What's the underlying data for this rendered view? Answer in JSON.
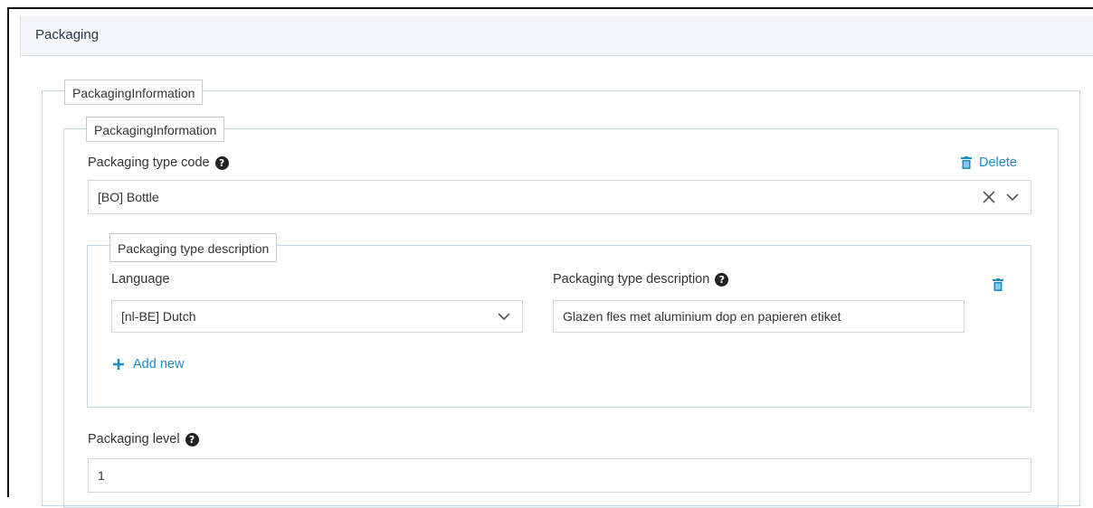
{
  "panel": {
    "title": "Packaging"
  },
  "outer_group": {
    "legend": "PackagingInformation"
  },
  "inner_group": {
    "legend": "PackagingInformation",
    "type_code": {
      "label": "Packaging type code",
      "value": "[BO] Bottle",
      "delete_label": "Delete"
    },
    "description_group": {
      "legend": "Packaging type description",
      "language": {
        "label": "Language",
        "value": "[nl-BE] Dutch"
      },
      "description": {
        "label": "Packaging type description",
        "value": "Glazen fles met aluminium dop en papieren etiket"
      },
      "add_new_label": "Add new"
    },
    "level": {
      "label": "Packaging level",
      "value": "1"
    }
  },
  "colors": {
    "accent": "#1b8bc4",
    "border": "#c6d6e4",
    "header_bg": "#f4f6f9"
  },
  "help_glyph": "?"
}
